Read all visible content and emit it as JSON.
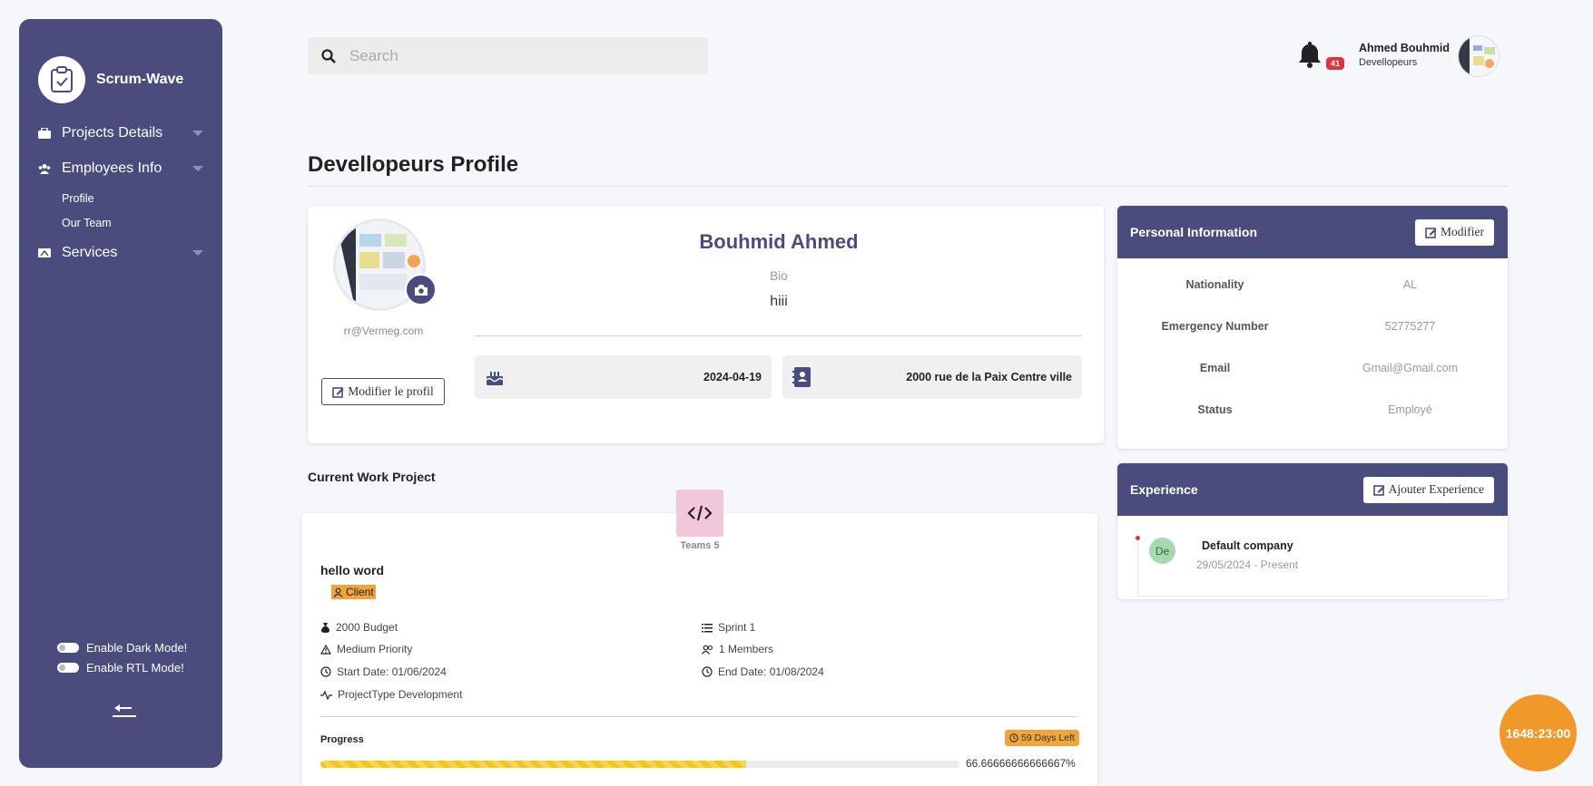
{
  "sidebar": {
    "brand": "Scrum-Wave",
    "items": [
      {
        "label": "Projects Details"
      },
      {
        "label": "Employees Info"
      },
      {
        "label": "Services"
      }
    ],
    "sub_items": [
      {
        "label": "Profile"
      },
      {
        "label": "Our Team"
      }
    ],
    "toggles": [
      {
        "label": "Enable Dark Mode!"
      },
      {
        "label": "Enable RTL Mode!"
      }
    ]
  },
  "header": {
    "search_placeholder": "Search",
    "notification_count": "41",
    "user_name": "Ahmed Bouhmid",
    "user_role": "Devellopeurs"
  },
  "page_title": "Devellopeurs Profile",
  "profile": {
    "name": "Bouhmid Ahmed",
    "bio_label": "Bio",
    "bio": "hiii",
    "email": "rr@Vermeg.com",
    "edit_button": "Modifier le profil",
    "birthday": "2024-04-19",
    "address": "2000 rue de la Paix Centre ville"
  },
  "personal_info": {
    "title": "Personal Information",
    "button": "Modifier",
    "rows": [
      {
        "key": "Nationality",
        "value": "AL"
      },
      {
        "key": "Emergency Number",
        "value": "52775277"
      },
      {
        "key": "Email",
        "value": "Gmail@Gmail.com"
      },
      {
        "key": "Status",
        "value": "Employé"
      }
    ]
  },
  "experience": {
    "title": "Experience",
    "button": "Ajouter Experience",
    "items": [
      {
        "initials": "De",
        "company": "Default company",
        "dates": "29/05/2024 - Present"
      }
    ]
  },
  "project": {
    "section_title": "Current Work Project",
    "teams": "Teams 5",
    "name": "hello word",
    "client_tag": "Client",
    "budget": "2000 Budget",
    "priority": "Medium Priority",
    "start": "Start Date: 01/06/2024",
    "type": "ProjectType Development",
    "sprint": "Sprint 1",
    "members": "1 Members",
    "end": "End Date: 01/08/2024",
    "progress_label": "Progress",
    "days_left": "59 Days Left",
    "progress_value": 66.66666666666667,
    "progress_text": "66.66666666666667%"
  },
  "timer": "1648:23:00",
  "colors": {
    "sidebar": "#4a4c7e",
    "accent_orange": "#f0a43a",
    "progress_yellow": "#f5c518",
    "badge_red": "#d9363e"
  }
}
